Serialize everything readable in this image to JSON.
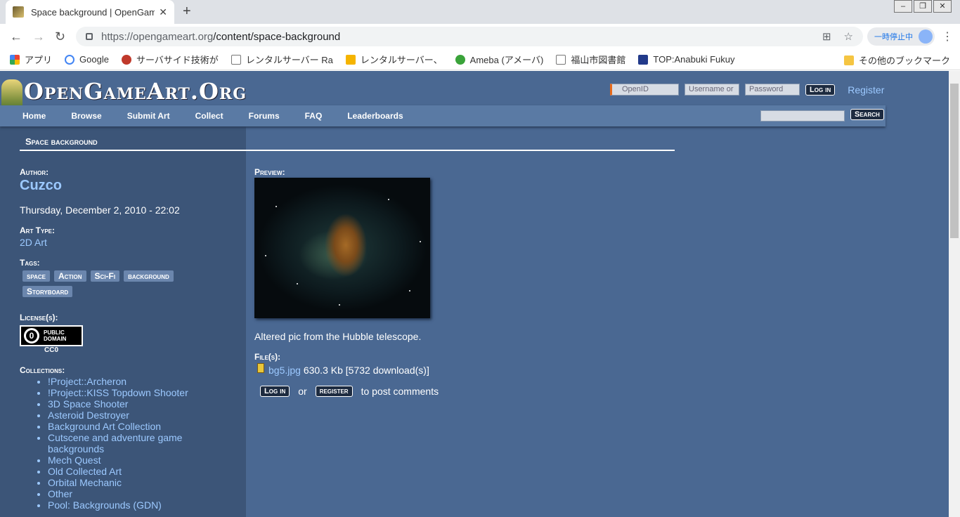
{
  "browser": {
    "tab_title": "Space background | OpenGameArt",
    "url_host": "https://opengameart.org",
    "url_path": "/content/space-background",
    "pause_label": "一時停止中",
    "bookmarks": [
      "アプリ",
      "Google",
      "サーバサイド技術が",
      "レンタルサーバー Ra",
      "レンタルサーバー、",
      "Ameba (アメーバ)",
      "福山市図書館",
      "TOP:Anabuki Fukuy"
    ],
    "other_bookmarks": "その他のブックマーク"
  },
  "site": {
    "logo": "OpenGameArt.Org",
    "login": {
      "openid": "OpenID",
      "username": "Username or",
      "password": "Password",
      "login_btn": "Log in",
      "register": "Register"
    },
    "nav": [
      "Home",
      "Browse",
      "Submit Art",
      "Collect",
      "Forums",
      "FAQ",
      "Leaderboards"
    ],
    "search_btn": "Search"
  },
  "content": {
    "title": "Space background",
    "author_label": "Author:",
    "author": "Cuzco",
    "date": "Thursday, December 2, 2010 - 22:02",
    "arttype_label": "Art Type:",
    "arttype": "2D Art",
    "tags_label": "Tags:",
    "tags": [
      "space",
      "Action",
      "Sci-Fi",
      "background",
      "Storyboard"
    ],
    "license_label": "License(s):",
    "license_badge": [
      "PUBLIC",
      "DOMAIN"
    ],
    "license_code": "CC0",
    "collections_label": "Collections:",
    "collections": [
      "!Project::Archeron",
      "!Project::KISS Topdown Shooter",
      "3D Space Shooter",
      "Asteroid Destroyer",
      "Background Art Collection",
      "Cutscene and adventure game backgrounds",
      "Mech Quest",
      "Old Collected Art",
      "Orbital Mechanic",
      "Other",
      "Pool: Backgrounds (GDN)"
    ],
    "preview_label": "Preview:",
    "description": "Altered pic from the Hubble telescope.",
    "files_label": "File(s):",
    "file_name": "bg5.jpg",
    "file_info": " 630.3 Kb [5732 download(s)]",
    "comments": {
      "login": "Log in",
      "or": "or",
      "register": "register",
      "suffix": "to post comments"
    }
  }
}
